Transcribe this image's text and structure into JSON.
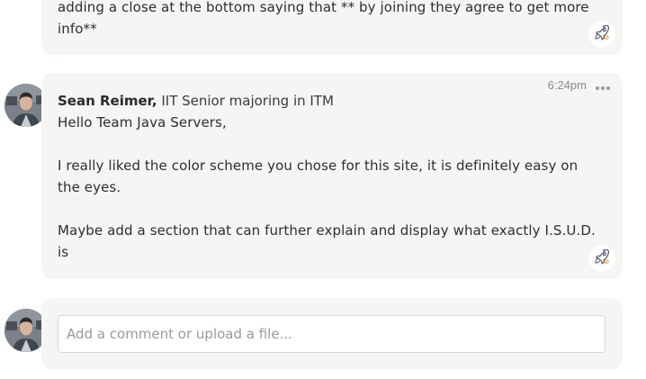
{
  "previous_comment": {
    "body": "adding a close at the bottom saying that ** by joining they agree to get more info**",
    "boost_icon": "rocket-boost-icon"
  },
  "comment": {
    "author_name": "Sean Reimer,",
    "author_title": "IIT Senior majoring in ITM",
    "timestamp": "6:24pm",
    "paragraphs": [
      "Hello Team Java Servers,",
      "I really liked the color scheme you chose for this site, it is definitely easy on the eyes.",
      "Maybe add a section that can further explain and display what exactly I.S.U.D. is"
    ],
    "more_icon": "ellipsis-icon",
    "boost_icon": "rocket-boost-icon"
  },
  "composer": {
    "placeholder": "Add a comment or upload a file...",
    "value": ""
  },
  "colors": {
    "card_background": "#f6f5f3",
    "boost_accent": "#f5a623",
    "muted_text": "#8a8a8a"
  }
}
